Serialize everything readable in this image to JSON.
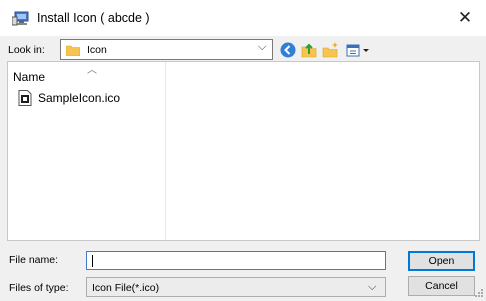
{
  "window": {
    "title": "Install Icon ( abcde )",
    "close_glyph": "✕",
    "app_icon": "install-computer-icon"
  },
  "toolbar": {
    "look_in_label": "Look in:",
    "look_in_value": "Icon",
    "buttons": [
      "back-icon",
      "up-folder-icon",
      "new-folder-icon",
      "view-menu-icon"
    ]
  },
  "file_list": {
    "column_name": "Name",
    "files": [
      {
        "name": "SampleIcon.ico",
        "icon": "ico-file-icon"
      }
    ]
  },
  "footer": {
    "file_name_label": "File name:",
    "file_name_value": "",
    "files_of_type_label": "Files of type:",
    "files_of_type_value": "Icon File(*.ico)",
    "open_label": "Open",
    "cancel_label": "Cancel"
  },
  "colors": {
    "accent": "#0078d7",
    "folder": "#f6c44f"
  }
}
